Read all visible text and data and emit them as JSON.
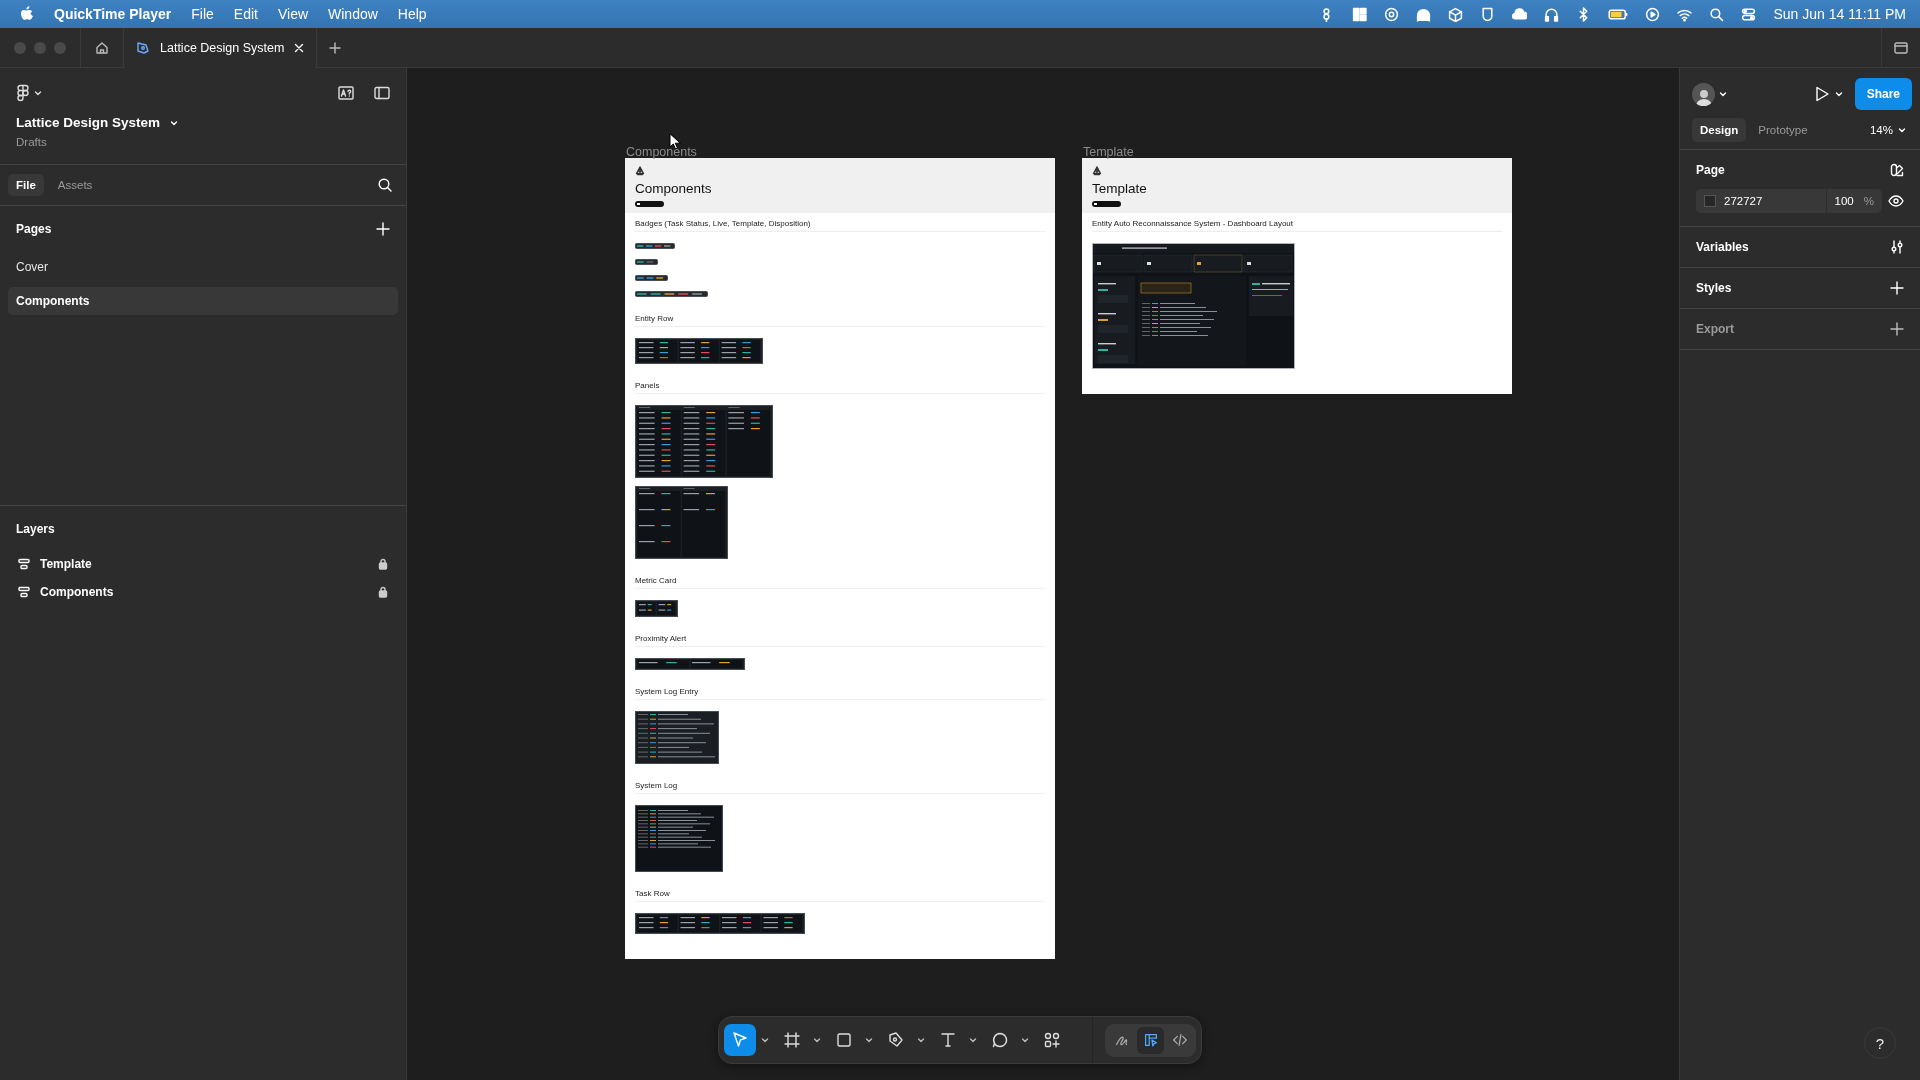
{
  "menu_bar": {
    "app": "QuickTime Player",
    "menus": [
      "File",
      "Edit",
      "View",
      "Window",
      "Help"
    ],
    "clock": "Sun Jun 14  11:11 PM"
  },
  "browser_tabs": [
    {
      "title": "Lattice Design System",
      "selected": true
    }
  ],
  "file": {
    "name": "Lattice Design System",
    "location": "Drafts"
  },
  "left_tabs": [
    {
      "label": "File",
      "selected": true
    },
    {
      "label": "Assets",
      "selected": false
    }
  ],
  "pages": {
    "title": "Pages",
    "items": [
      {
        "label": "Cover",
        "selected": false
      },
      {
        "label": "Components",
        "selected": true
      }
    ]
  },
  "layers": {
    "title": "Layers",
    "items": [
      {
        "label": "Template",
        "locked": true
      },
      {
        "label": "Components",
        "locked": true
      }
    ]
  },
  "right_panel": {
    "share": "Share",
    "tabs": [
      {
        "label": "Design",
        "selected": true
      },
      {
        "label": "Prototype",
        "selected": false
      }
    ],
    "zoom": "14%",
    "page": {
      "title": "Page",
      "color": "272727",
      "opacity": "100",
      "unit": "%"
    },
    "sections": [
      {
        "title": "Variables",
        "kind": "variables",
        "disabled": false
      },
      {
        "title": "Styles",
        "kind": "add",
        "disabled": false
      },
      {
        "title": "Export",
        "kind": "add",
        "disabled": true
      }
    ]
  },
  "canvas": {
    "frames": [
      {
        "label": "Components",
        "title": "Components",
        "sections": [
          {
            "title": "Badges (Task Status, Live, Template, Disposition)",
            "previews": [
              {
                "kind": "status-badges"
              },
              {
                "kind": "live-badges"
              },
              {
                "kind": "template-badges"
              },
              {
                "kind": "disposition-badges"
              }
            ]
          },
          {
            "title": "Entity Row",
            "previews": [
              {
                "kind": "entity-row"
              }
            ]
          },
          {
            "title": "Panels",
            "previews": [
              {
                "kind": "entity-panel"
              },
              {
                "kind": "task-panel"
              }
            ]
          },
          {
            "title": "Metric Card",
            "previews": [
              {
                "kind": "metric-card"
              }
            ]
          },
          {
            "title": "Proximity Alert",
            "previews": [
              {
                "kind": "proximity-alert"
              }
            ]
          },
          {
            "title": "System Log Entry",
            "previews": [
              {
                "kind": "log-entry"
              }
            ]
          },
          {
            "title": "System Log",
            "previews": [
              {
                "kind": "system-log"
              }
            ]
          },
          {
            "title": "Task Row",
            "previews": [
              {
                "kind": "task-row"
              }
            ]
          }
        ]
      },
      {
        "label": "Template",
        "title": "Template",
        "sections": [
          {
            "title": "Entity Auto Reconnaissance System - Dashboard Layout",
            "previews": [
              {
                "kind": "dashboard"
              }
            ]
          }
        ]
      }
    ]
  },
  "toolbar": {
    "tools": [
      {
        "kind": "move",
        "selected": true,
        "has_menu": true
      },
      {
        "kind": "frame",
        "selected": false,
        "has_menu": true
      },
      {
        "kind": "shape",
        "selected": false,
        "has_menu": true
      },
      {
        "kind": "pen",
        "selected": false,
        "has_menu": true
      },
      {
        "kind": "text",
        "selected": false,
        "has_menu": true
      },
      {
        "kind": "comment",
        "selected": false,
        "has_menu": true
      },
      {
        "kind": "actions",
        "selected": false,
        "has_menu": false
      }
    ],
    "modes": [
      {
        "kind": "draw",
        "selected": false
      },
      {
        "kind": "design",
        "selected": true
      },
      {
        "kind": "dev",
        "selected": false
      }
    ]
  },
  "help": "?"
}
